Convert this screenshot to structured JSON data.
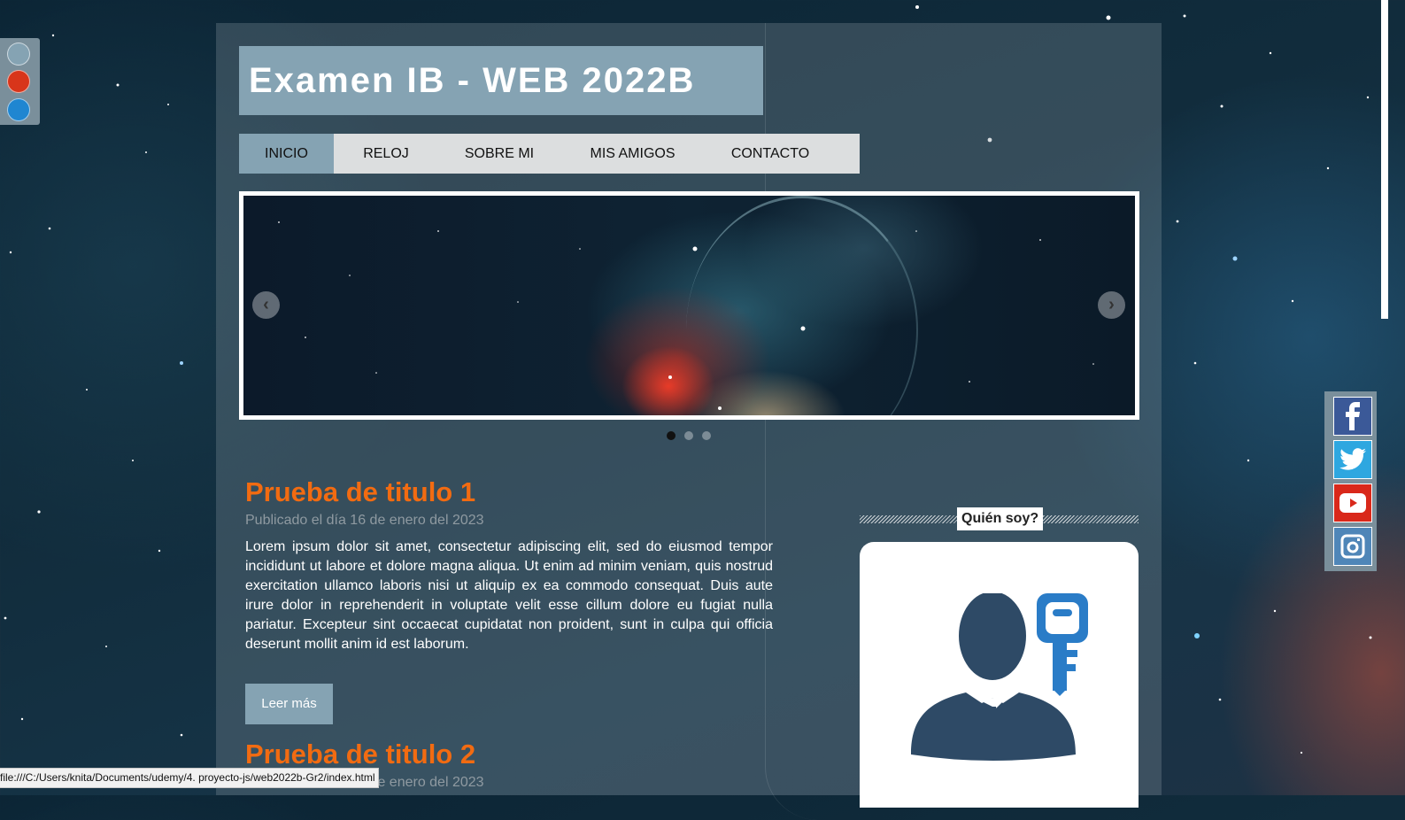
{
  "theme_switcher": {
    "colors": [
      "#85a3b3",
      "#d8351a",
      "#1f86d1"
    ]
  },
  "header": {
    "site_title": "Examen IB - WEB 2022B"
  },
  "nav": {
    "items": [
      {
        "label": "INICIO",
        "active": true
      },
      {
        "label": "RELOJ",
        "active": false
      },
      {
        "label": "SOBRE MI",
        "active": false
      },
      {
        "label": "MIS AMIGOS",
        "active": false
      },
      {
        "label": "CONTACTO",
        "active": false
      }
    ]
  },
  "slider": {
    "prev_icon": "chevron-left-icon",
    "next_icon": "chevron-right-icon",
    "pager_count": 3,
    "active_index": 0
  },
  "articles": [
    {
      "title": "Prueba de titulo 1",
      "date": "Publicado el día 16 de enero del 2023",
      "body": "Lorem ipsum dolor sit amet, consectetur adipiscing elit, sed do eiusmod tempor incididunt ut labore et dolore magna aliqua. Ut enim ad minim veniam, quis nostrud exercitation ullamco laboris nisi ut aliquip ex ea commodo consequat. Duis aute irure dolor in reprehenderit in voluptate velit esse cillum dolore eu fugiat nulla pariatur. Excepteur sint occaecat cupidatat non proident, sunt in culpa qui officia deserunt mollit anim id est laborum.",
      "read_more": "Leer más"
    },
    {
      "title": "Prueba de titulo 2",
      "date": "Publicado el día 16 de enero del 2023"
    }
  ],
  "aside": {
    "title": "Quién soy?",
    "avatar_icon": "user-key-icon"
  },
  "social": {
    "items": [
      {
        "icon": "facebook-icon",
        "color": "#3b5998"
      },
      {
        "icon": "twitter-icon",
        "color": "#2ea7e0"
      },
      {
        "icon": "youtube-icon",
        "color": "#d9281a"
      },
      {
        "icon": "instagram-icon",
        "color": "#4f86b8"
      }
    ]
  },
  "status_bar": {
    "url": "file:///C:/Users/knita/Documents/udemy/4. proyecto-js/web2022b-Gr2/index.html"
  },
  "colors": {
    "accent": "#85a3b3",
    "title_orange": "#f26b11"
  }
}
